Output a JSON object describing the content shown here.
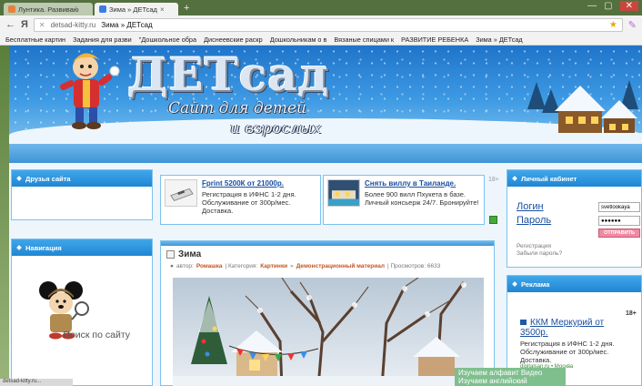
{
  "browser": {
    "tabs": [
      {
        "label": "Лунтика. Развиваю́",
        "active": false
      },
      {
        "label": "Зима » ДЕТсад",
        "active": true
      }
    ],
    "address": {
      "host": "detsad-kitty.ru",
      "title": "Зима » ДЕТсад"
    },
    "bookmarks": [
      "Бесплатные картин",
      "Задания для разви",
      "\"Дошкольное обра",
      "Диснеевские раскр",
      "Дошкольникам о в",
      "Вязаные спицами к",
      "РАЗВИТИЕ РЕБЕНКА",
      "Зима » ДЕТсад"
    ]
  },
  "header": {
    "logo": "ДЕТсад",
    "tagline_1": "Сайт для детей",
    "tagline_2": "и взрослых"
  },
  "left": {
    "friends_title": "Друзья сайта",
    "nav_title": "Навигация",
    "search_text": "Поиск по сайту"
  },
  "ads": [
    {
      "title": "Fprint 5200К от 21000р.",
      "desc": "Регистрация в ИФНС 1-2 дня. Обслуживание от 300р/мес. Доставка."
    },
    {
      "title": "Снять виллу в Таиланде.",
      "desc": "Более 900 вилл Пхукета в базе. Личный консьерж 24/7. Бронируйте!"
    }
  ],
  "age_badge": "18+",
  "article": {
    "title": "Зима",
    "author_label": "автор:",
    "author": "Ромашка",
    "category_label": "| Категория:",
    "cat1": "Картинки",
    "sep": "»",
    "cat2": "Демонстрационный материал",
    "views": "| Просмотров: 6633"
  },
  "cabinet": {
    "title": "Личный кабинет",
    "login_label": "Логин",
    "password_label": "Пароль",
    "login_value": "svetlookaya",
    "password_value": "●●●●●●",
    "submit": "ОТПРАВИТЬ",
    "register": "Регистрация",
    "forgot": "Забыли пароль?"
  },
  "ads_right": {
    "title": "Реклама",
    "age": "18+",
    "ad_title": "ККМ Меркурий от 3500р.",
    "ad_desc": "Регистрация в ИФНС 1-2 дня. Обслуживание от 300р/мес. Доставка.",
    "ad_url": "digitalsan.ru • Москва"
  },
  "popup": {
    "line1": "Изучаем алфавит Видео",
    "line2": "Изучаем английский"
  },
  "status": "detsad-kitty.ru..."
}
